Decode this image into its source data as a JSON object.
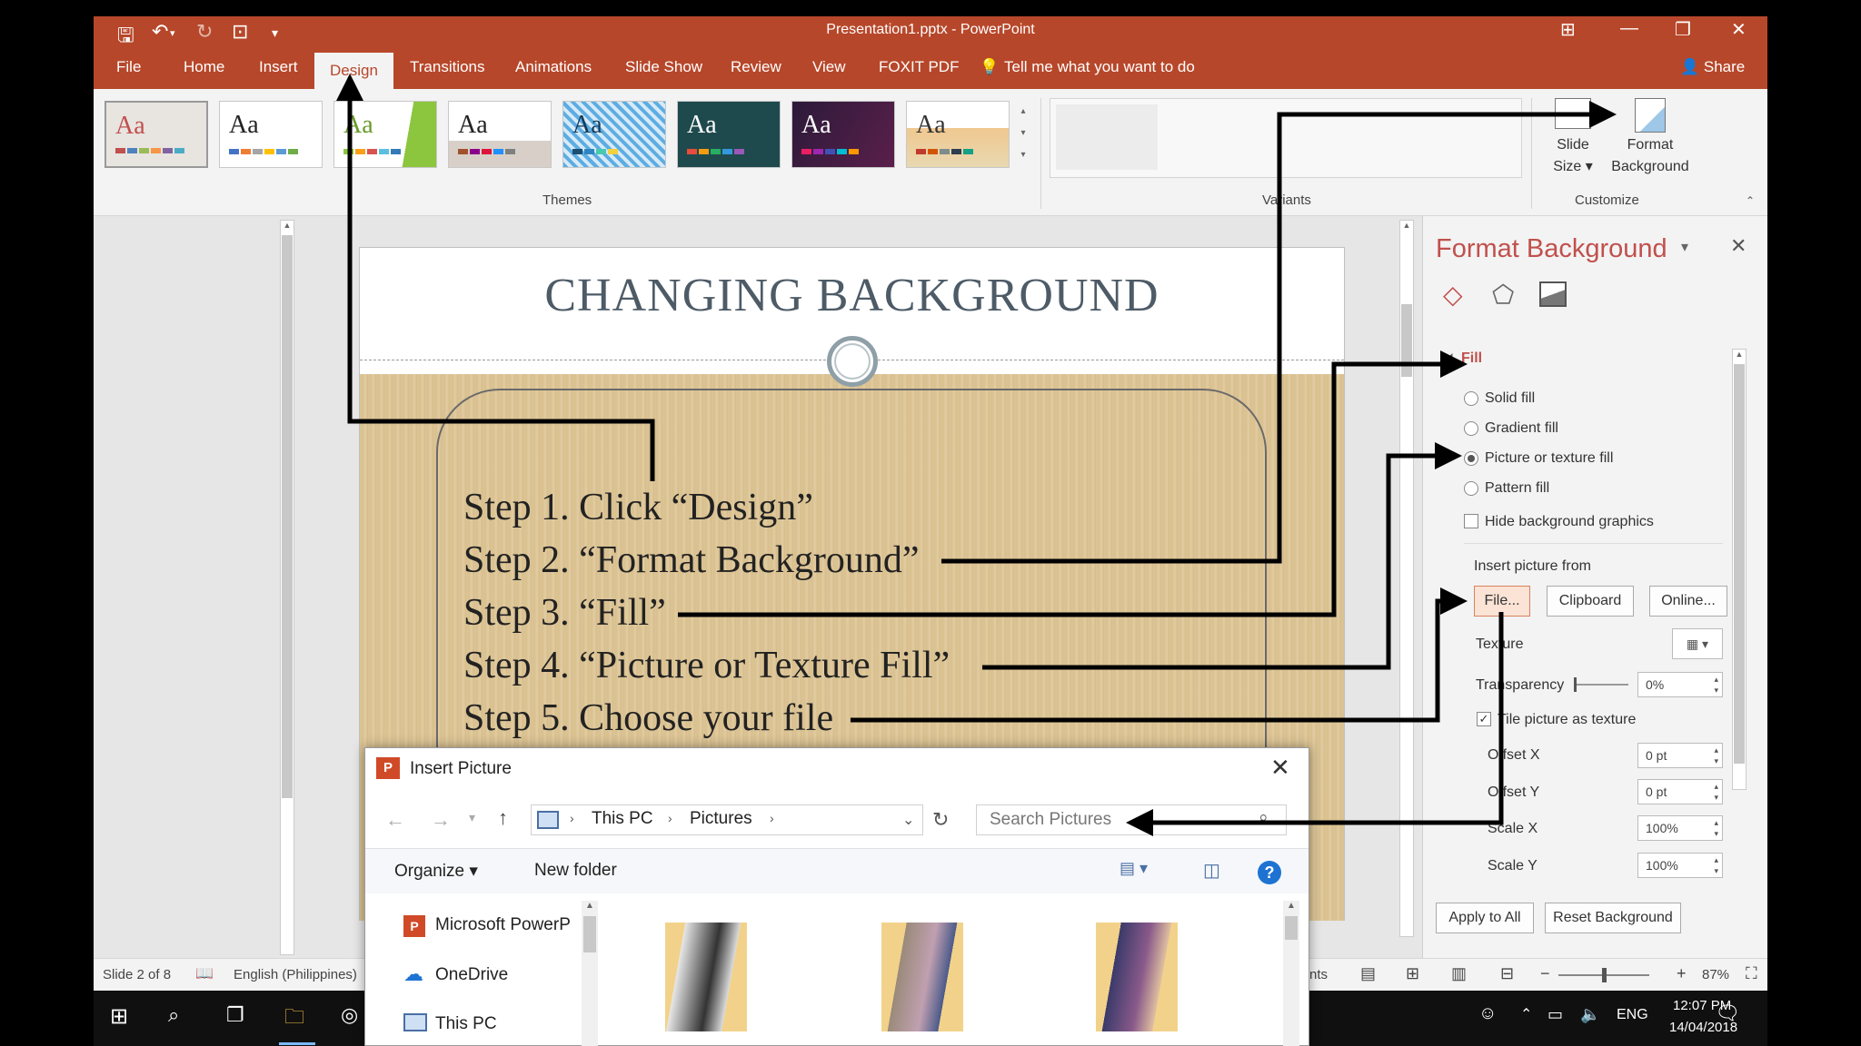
{
  "window": {
    "title": "Presentation1.pptx - PowerPoint",
    "accent": "#b7472a"
  },
  "qat": {
    "icons": [
      "save-icon",
      "undo-icon",
      "redo-icon",
      "start-from-beginning-icon",
      "customize-qat-icon"
    ]
  },
  "tabs": [
    "File",
    "Home",
    "Insert",
    "Design",
    "Transitions",
    "Animations",
    "Slide Show",
    "Review",
    "View",
    "FOXIT PDF"
  ],
  "active_tab": "Design",
  "tell_me": "Tell me what you want to do",
  "share": "Share",
  "ribbon": {
    "themes_label": "Themes",
    "variants_label": "Variants",
    "customize_label": "Customize",
    "slide_size": "Slide Size",
    "slide_size_line1": "Slide",
    "slide_size_line2": "Size",
    "format_background_line1": "Format",
    "format_background_line2": "Background",
    "theme_sample": "Aa"
  },
  "slide": {
    "title": "CHANGING BACKGROUND",
    "steps": [
      "Step 1. Click “Design”",
      "Step 2. “Format Background”",
      "Step 3. “Fill”",
      "Step 4.  “Picture or Texture Fill”",
      "Step 5. Choose your file"
    ]
  },
  "format_pane": {
    "title": "Format Background",
    "fill_section": "Fill",
    "options": [
      "Solid fill",
      "Gradient fill",
      "Picture or texture fill",
      "Pattern fill"
    ],
    "selected_option": "Picture or texture fill",
    "hide_graphics": "Hide background graphics",
    "insert_from": "Insert picture from",
    "file_btn": "File...",
    "clipboard_btn": "Clipboard",
    "online_btn": "Online...",
    "texture": "Texture",
    "transparency": "Transparency",
    "transparency_value": "0%",
    "tile": "Tile picture as texture",
    "offset_x": "Offset X",
    "offset_x_value": "0 pt",
    "offset_y": "Offset Y",
    "offset_y_value": "0 pt",
    "scale_x": "Scale X",
    "scale_x_value": "100%",
    "scale_y": "Scale Y",
    "scale_y_value": "100%",
    "apply_all": "Apply to All",
    "reset": "Reset Background"
  },
  "status": {
    "slide": "Slide 2 of 8",
    "language": "English (Philippines)",
    "notes_partial": "nts",
    "zoom": "87%"
  },
  "dialog": {
    "title": "Insert Picture",
    "path": [
      "This PC",
      "Pictures"
    ],
    "search_placeholder": "Search Pictures",
    "organize": "Organize",
    "new_folder": "New folder",
    "nav": [
      "Microsoft PowerP",
      "OneDrive",
      "This PC"
    ]
  },
  "taskbar": {
    "language": "ENG",
    "time": "12:07 PM",
    "date": "14/04/2018"
  }
}
